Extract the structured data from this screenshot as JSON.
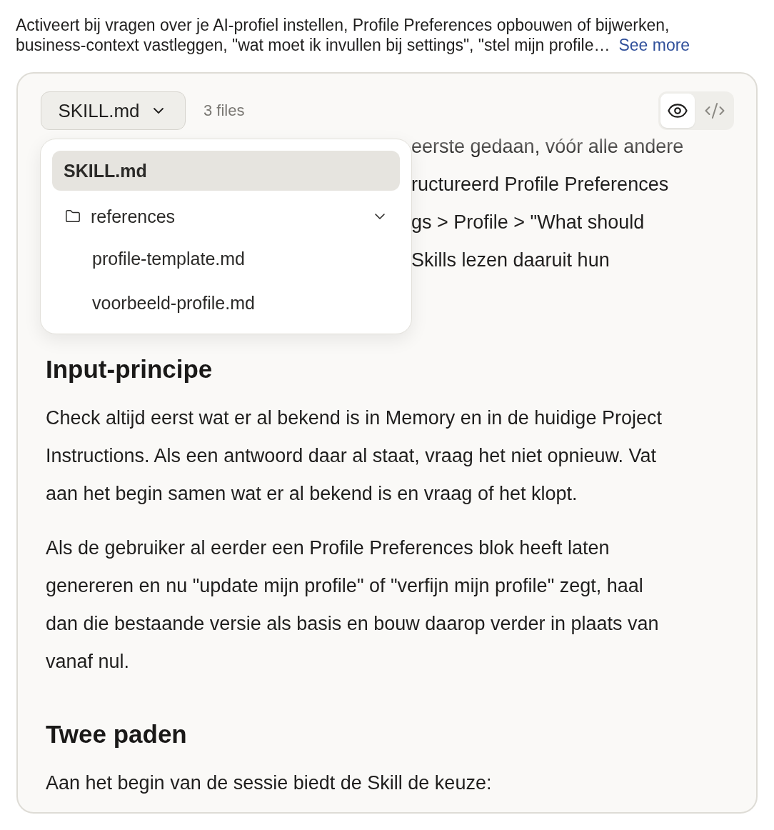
{
  "description": {
    "text": "Activeert bij vragen over je AI-profiel instellen, Profile Preferences opbouwen of bijwerken, business-context vastleggen, \"wat moet ik invullen bij settings\", \"stel mijn profile…",
    "link": "See more"
  },
  "file_viewer": {
    "file_select": {
      "label": "SKILL.md",
      "expanded": true
    },
    "file_count": "3 files",
    "view_toggle": [
      {
        "kind": "preview",
        "selected": true
      },
      {
        "kind": "code",
        "selected": false
      }
    ],
    "dropdown": {
      "items": [
        {
          "kind": "file",
          "label": "SKILL.md",
          "selected": true
        },
        {
          "kind": "folder",
          "label": "references",
          "expanded": true,
          "children": [
            {
              "kind": "file",
              "label": "profile-template.md",
              "selected": false
            },
            {
              "kind": "file",
              "label": "voorbeeld-profile.md",
              "selected": false
            }
          ]
        }
      ]
    },
    "content": [
      {
        "kind": "partial_lines",
        "lines": [
          "eerste gedaan, vóór alle andere",
          "ructureerd Profile Preferences",
          "gs > Profile > \"What should",
          "Skills lezen daaruit hun"
        ]
      },
      {
        "kind": "heading",
        "text": "Input-principe"
      },
      {
        "kind": "paragraph",
        "text": "Check altijd eerst wat er al bekend is in Memory en in de huidige Project Instructions. Als een antwoord daar al staat, vraag het niet opnieuw. Vat aan het begin samen wat er al bekend is en vraag of het klopt."
      },
      {
        "kind": "paragraph",
        "text": "Als de gebruiker al eerder een Profile Preferences blok heeft laten genereren en nu \"update mijn profile\" of \"verfijn mijn profile\" zegt, haal dan die bestaande versie als basis en bouw daarop verder in plaats van vanaf nul."
      },
      {
        "kind": "heading",
        "text": "Twee paden"
      },
      {
        "kind": "paragraph",
        "text": "Aan het begin van de sessie biedt de Skill de keuze:"
      }
    ]
  }
}
